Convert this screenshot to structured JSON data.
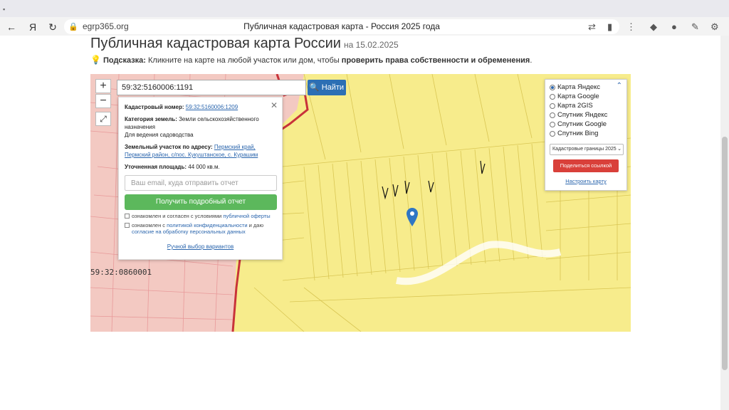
{
  "browser": {
    "url": "egrp365.org",
    "tab_title": "Публичная кадастровая карта - Россия 2025 года"
  },
  "page": {
    "title": "Публичная кадастровая карта России",
    "date_prefix": "на 15.02.2025",
    "hint_label": "Подсказка:",
    "hint_text": " Кликните на карте на любой участок или дом, чтобы ",
    "hint_bold": "проверить права собственности и обременения",
    "hint_end": "."
  },
  "search": {
    "value": "59:32:5160006:1191",
    "button": "Найти"
  },
  "info": {
    "cad_label": "Кадастровый номер:",
    "cad_value": "59:32:5160006:1209",
    "cat_label": "Категория земель:",
    "cat_value": "Земли сельскохозяйственного назначения",
    "cat_use": "Для ведения садоводства",
    "addr_label": "Земельный участок по адресу:",
    "addr_value": "Пермский край, Пермский район, с/пос. Кукуштанское, с. Курашим",
    "area_label": "Уточненная площадь:",
    "area_value": "44 000 кв.м.",
    "email_placeholder": "Ваш email, куда отправить отчет",
    "report_button": "Получить подробный отчет",
    "consent1_a": "ознакомлен и согласен с условиями ",
    "consent1_link": "публичной оферты",
    "consent2_a": "ознакомлен с ",
    "consent2_link": "политикой конфиденциальности",
    "consent2_b": " и даю ",
    "consent2_link2": "согласие на обработку персональных данных",
    "manual": "Ручной выбор вариантов"
  },
  "layers": {
    "options": [
      "Карта Яндекс",
      "Карта Google",
      "Карта 2GIS",
      "Спутник Яндекс",
      "Спутник Google",
      "Спутник Bing"
    ],
    "selected": "Карта Яндекс",
    "select_value": "Кадастровые границы 2025",
    "share_button": "Поделиться ссылкой",
    "setup_link": "Настроить карту"
  },
  "map": {
    "label": "59:32:0860001"
  },
  "colors": {
    "parcel_fill": "#f7ec8c",
    "urban_fill": "#f3c9c2",
    "border_red": "#c8323a",
    "search_blue": "#2c6fb4",
    "report_green": "#5cb85c",
    "share_red": "#d9403a",
    "pin_blue": "#2f76c4"
  }
}
